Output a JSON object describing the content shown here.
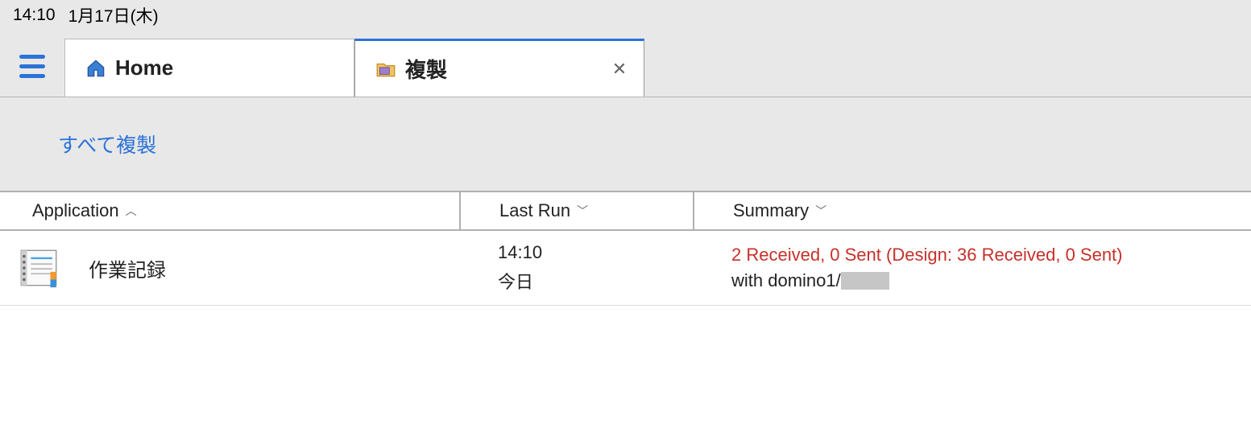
{
  "status": {
    "time": "14:10",
    "date": "1月17日(木)"
  },
  "tabs": [
    {
      "label": "Home",
      "icon": "home-icon"
    },
    {
      "label": "複製",
      "icon": "folder-icon"
    }
  ],
  "toolbar": {
    "replicate_all": "すべて複製"
  },
  "table": {
    "headers": {
      "application": "Application",
      "last_run": "Last Run",
      "summary": "Summary"
    },
    "rows": [
      {
        "application": "作業記録",
        "last_run_time": "14:10",
        "last_run_date": "今日",
        "summary_status": "2 Received, 0 Sent   (Design: 36 Received, 0 Sent)",
        "summary_server_prefix": "with domino1/"
      }
    ]
  }
}
